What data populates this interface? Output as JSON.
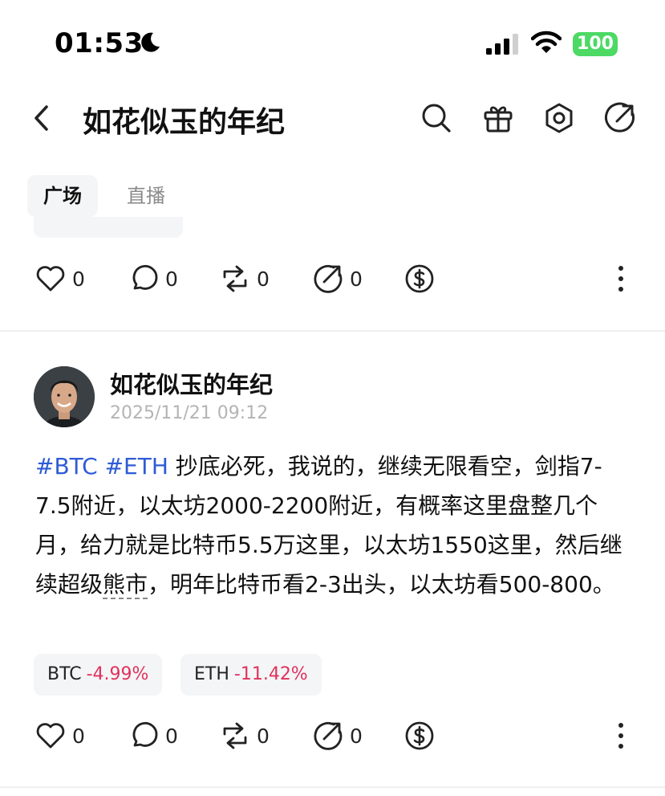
{
  "status_bar": {
    "time": "01:53",
    "battery": "100"
  },
  "header": {
    "title": "如花似玉的年纪"
  },
  "tabs": [
    {
      "label": "广场",
      "active": true
    },
    {
      "label": "直播",
      "active": false
    }
  ],
  "prev_post": {
    "actions": {
      "likes": "0",
      "comments": "0",
      "reposts": "0",
      "shares": "0"
    }
  },
  "post": {
    "author": "如花似玉的年纪",
    "date": "2025/11/21 09:12",
    "hashtags": [
      "#BTC",
      "#ETH"
    ],
    "text_part1": " 抄底必死，我说的，继续无限看空，剑指7-7.5附近，以太坊2000-2200附近，有概率这里盘整几个月，给力就是比特币5.5万这里，以太坊1550这里，然后继续超级",
    "text_dotted": "熊市",
    "text_part2": "，明年比特币看2-3出头，以太坊看500-800。",
    "tickers": [
      {
        "symbol": "BTC",
        "change": "-4.99%"
      },
      {
        "symbol": "ETH",
        "change": "-11.42%"
      }
    ],
    "actions": {
      "likes": "0",
      "comments": "0",
      "reposts": "0",
      "shares": "0"
    }
  },
  "colors": {
    "hashtag": "#2e5bd6",
    "negative": "#e0325e",
    "battery": "#4cd964"
  }
}
